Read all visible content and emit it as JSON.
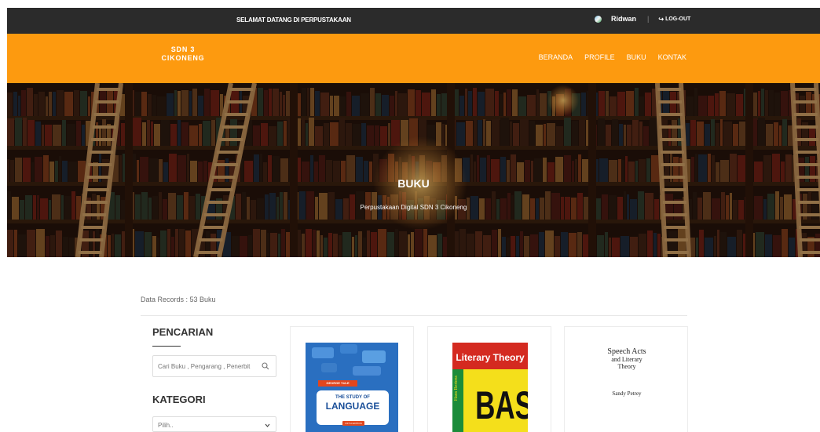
{
  "topbar": {
    "welcome": "SELAMAT DATANG DI PERPUSTAKAAN",
    "user_name": "Ridwan",
    "separator": "|",
    "logout_label": "LOG-OUT"
  },
  "header": {
    "logo_line1": "SDN 3",
    "logo_line2": "CIKONENG",
    "nav": [
      "BERANDA",
      "PROFILE",
      "BUKU",
      "KONTAK"
    ]
  },
  "hero": {
    "title": "BUKU",
    "subtitle": "Perpustakaan Digital SDN 3 Cikoneng"
  },
  "content": {
    "records": "Data Records : 53 Buku",
    "search_title": "PENCARIAN",
    "search_placeholder": "Cari Buku , Pengarang , Penerbit",
    "kategori_title": "KATEGORI",
    "kategori_selected": "Pilih.."
  },
  "books": [
    {
      "author": "GEORGE YULE",
      "title_small": "THE STUDY OF",
      "title_big": "LANGUAGE",
      "edition": "FIFTH EDITION"
    },
    {
      "title": "Literary Theory",
      "author": "Hans Bertens",
      "subtitle": "BASICS"
    },
    {
      "title_line1": "Speech Acts",
      "title_line2": "and Literary",
      "title_line3": "Theory",
      "author": "Sandy Petrey"
    }
  ],
  "colors": {
    "topbar": "#2b2b2b",
    "header": "#fd9a0f",
    "accent_text": "#ffffff"
  },
  "icons": {
    "logout": "logout-icon",
    "search": "search-icon",
    "select": "chevron-down-icon",
    "avatar": "avatar"
  }
}
